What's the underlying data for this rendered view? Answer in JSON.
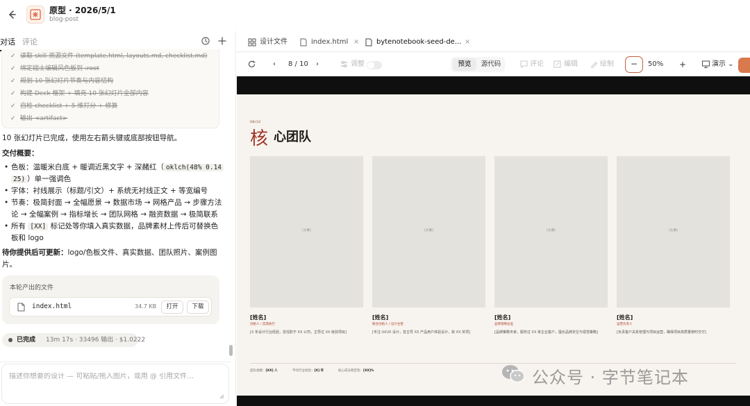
{
  "header": {
    "title": "原型 · 2026/5/1",
    "subtitle": "blog-post"
  },
  "left": {
    "tabs": [
      "对话",
      "评论"
    ],
    "checklist": [
      "读取 skill 资源文件 (template.html, layouts.md, checklist.md)",
      "绑定瑞士编辑风色板到 :root",
      "规划 10 张幻灯片节奏与内容结构",
      "构建 Deck 框架 + 填充 10 张幻灯片全部内容",
      "自检 checklist + 5 维打分 + 修复",
      "输出 <artifact>"
    ],
    "intro": "10 张幻灯片已完成，使用左右箭头键或底部按钮导航。",
    "summary_title": "交付概要：",
    "bullets": [
      {
        "pre": "色板：温暖米白底 + 暖调近黑文字 + 深赭红（",
        "code": "oklch(48% 0.14",
        "line2_code": "25)",
        "line2": "）单一强调色"
      },
      {
        "text": "字体：衬线展示（标题/引文）+ 系统无衬线正文 + 等宽编号"
      },
      {
        "text": "节奏：极简封面 → 全幅愿景 → 数据市场 → 网格产品 → 步骤方法",
        "line2": "论 → 全幅案例 → 指标增长 → 团队网格 → 融资数据 → 极简联系"
      },
      {
        "pre": "所有 ",
        "code": "[XX]",
        "post": " 标记处等你填入真实数据，品牌素材上传后可替换色",
        "line2": "板和 logo"
      }
    ],
    "pending_label": "待你提供后可更新：",
    "pending_text": "logo/色板文件、真实数据、团队照片、案例图",
    "pending_line2": "片。",
    "files_title": "本轮产出的文件",
    "file": {
      "name": "index.html",
      "size": "34.7 KB",
      "open": "打开",
      "download": "下载"
    },
    "status": {
      "label": "已完成",
      "meta": "13m 17s · 33496 输出 · $1.0222"
    },
    "composer_placeholder": "描述你想要的设计 — 可粘贴/拖入图片，或用 @ 引用文件…"
  },
  "right": {
    "tabs": [
      {
        "label": "设计文件"
      },
      {
        "label": "index.html"
      },
      {
        "label": "bytenotebook-seed-de..."
      }
    ],
    "toolbar": {
      "page": "8 / 10",
      "adjust": "调整",
      "preview": "预览",
      "source": "源代码",
      "comment": "评论",
      "edit": "编辑",
      "draw": "绘制",
      "minus": "−",
      "zoom": "50%",
      "plus": "+",
      "present": "演示"
    },
    "slide": {
      "kicker": "08/10",
      "title_accent": "核",
      "title_rest": "心团队",
      "members": [
        {
          "photo": "[头像]",
          "name": "[姓名]",
          "role": "创始人 / 首席执行",
          "desc": "[X 年设计行业经验，曾任职于 XX 公司，主导过 XX 级别项目]"
        },
        {
          "photo": "[头像]",
          "name": "[姓名]",
          "role": "联合创始人 / 设计主管",
          "desc": "[专注 UI/UX 设计，曾主导 XX 产品用户体验设计，获 XX 奖项]"
        },
        {
          "photo": "[头像]",
          "name": "[姓名]",
          "role": "品牌策略总监",
          "desc": "[品牌策略专家，服务过 XX 家企业客户，擅长品牌定位与视觉策略]"
        },
        {
          "photo": "[头像]",
          "name": "[姓名]",
          "role": "运营负责人",
          "desc": "[负责客户关系管理与项目运营，确保项目高质量按时交付]"
        }
      ],
      "footer_stats": [
        {
          "label": "团队规模：",
          "value": "[XX] 人"
        },
        {
          "label": "平均行业经验：",
          "value": "[X] 年"
        },
        {
          "label": "核心成员稳定性：",
          "value": "[XX]%"
        }
      ]
    }
  },
  "watermark": "公众号 · 字节笔记本",
  "colors": {
    "accent": "#a0362a",
    "slide_bg": "#f7f3ee",
    "zoom_outline": "#c0613b",
    "present": "#d97a4e"
  }
}
